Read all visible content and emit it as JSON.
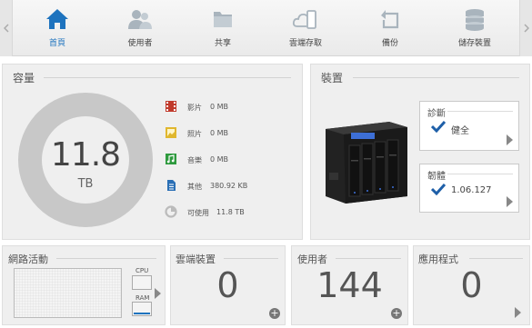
{
  "nav": {
    "items": [
      {
        "label": "首頁",
        "icon": "home-icon"
      },
      {
        "label": "使用者",
        "icon": "users-icon"
      },
      {
        "label": "共享",
        "icon": "folder-icon"
      },
      {
        "label": "雲端存取",
        "icon": "cloud-mobile-icon"
      },
      {
        "label": "備份",
        "icon": "backup-icon"
      },
      {
        "label": "儲存裝置",
        "icon": "storage-icon"
      }
    ],
    "active_index": 0
  },
  "capacity": {
    "title": "容量",
    "total_value": "11.8",
    "total_unit": "TB",
    "legend": [
      {
        "label": "影片",
        "value": "0 MB",
        "icon": "video-icon",
        "color": "#c0392b"
      },
      {
        "label": "照片",
        "value": "0 MB",
        "icon": "photo-icon",
        "color": "#e0b72e"
      },
      {
        "label": "音樂",
        "value": "0 MB",
        "icon": "music-icon",
        "color": "#2e9a3e"
      },
      {
        "label": "其他",
        "value": "380.92 KB",
        "icon": "document-icon",
        "color": "#2a6fb5"
      },
      {
        "label": "可使用",
        "value": "11.8 TB",
        "icon": "free-space-icon",
        "color": "#bbbbbb"
      }
    ]
  },
  "device": {
    "title": "裝置",
    "diagnostics": {
      "title": "診斷",
      "value": "健全"
    },
    "firmware": {
      "title": "韌體",
      "value": "1.06.127"
    }
  },
  "network": {
    "title": "網路活動",
    "cpu_label": "CPU",
    "ram_label": "RAM"
  },
  "cloud_devices": {
    "title": "雲端裝置",
    "count": "0"
  },
  "users": {
    "title": "使用者",
    "count": "144"
  },
  "apps": {
    "title": "應用程式",
    "count": "0"
  },
  "colors": {
    "accent": "#1e73be",
    "donut": "#c8c8c8",
    "panel": "#efefef"
  }
}
